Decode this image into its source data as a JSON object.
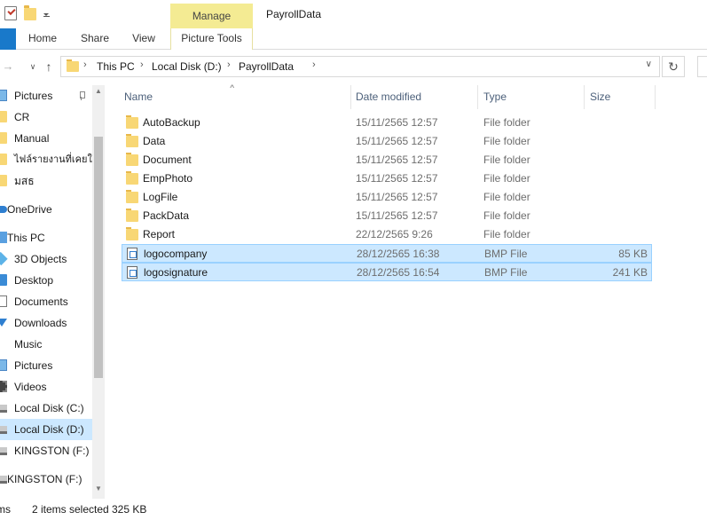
{
  "quick_access_toolbar": {
    "icons": [
      "properties-check-icon",
      "new-folder-icon",
      "customize-dropdown-icon"
    ]
  },
  "ribbon": {
    "contextual_group": "Manage",
    "tabs": [
      {
        "label": "Home"
      },
      {
        "label": "Share"
      },
      {
        "label": "View"
      },
      {
        "label": "Picture Tools"
      }
    ]
  },
  "window": {
    "title": "PayrollData"
  },
  "address": {
    "crumbs": [
      "This PC",
      "Local Disk (D:)",
      "PayrollData"
    ]
  },
  "nav_pane": {
    "items": [
      {
        "label": "Pictures",
        "icon": "pictures-icon",
        "pinned": true
      },
      {
        "label": "CR",
        "icon": "folder-icon"
      },
      {
        "label": "Manual",
        "icon": "folder-icon"
      },
      {
        "label": "ไฟล์รายงานที่เคยใช้",
        "icon": "folder-icon"
      },
      {
        "label": "มสธ",
        "icon": "folder-icon"
      },
      {
        "label": "OneDrive",
        "icon": "onedrive-icon"
      },
      {
        "label": "This PC",
        "icon": "this-pc-icon"
      },
      {
        "label": "3D Objects",
        "icon": "3d-objects-icon"
      },
      {
        "label": "Desktop",
        "icon": "desktop-icon"
      },
      {
        "label": "Documents",
        "icon": "documents-icon"
      },
      {
        "label": "Downloads",
        "icon": "downloads-icon"
      },
      {
        "label": "Music",
        "icon": "music-icon"
      },
      {
        "label": "Pictures",
        "icon": "pictures-icon"
      },
      {
        "label": "Videos",
        "icon": "videos-icon"
      },
      {
        "label": "Local Disk (C:)",
        "icon": "drive-icon"
      },
      {
        "label": "Local Disk (D:)",
        "icon": "drive-icon",
        "selected": true
      },
      {
        "label": "KINGSTON (F:)",
        "icon": "usb-drive-icon"
      },
      {
        "label": "KINGSTON (F:)",
        "icon": "usb-drive-icon"
      }
    ]
  },
  "file_list": {
    "columns": {
      "name": "Name",
      "date": "Date modified",
      "type": "Type",
      "size": "Size"
    },
    "rows": [
      {
        "name": "AutoBackup",
        "date": "15/11/2565 12:57",
        "type": "File folder",
        "size": "",
        "icon": "folder-icon",
        "selected": false
      },
      {
        "name": "Data",
        "date": "15/11/2565 12:57",
        "type": "File folder",
        "size": "",
        "icon": "folder-icon",
        "selected": false
      },
      {
        "name": "Document",
        "date": "15/11/2565 12:57",
        "type": "File folder",
        "size": "",
        "icon": "folder-icon",
        "selected": false
      },
      {
        "name": "EmpPhoto",
        "date": "15/11/2565 12:57",
        "type": "File folder",
        "size": "",
        "icon": "folder-icon",
        "selected": false
      },
      {
        "name": "LogFile",
        "date": "15/11/2565 12:57",
        "type": "File folder",
        "size": "",
        "icon": "folder-icon",
        "selected": false
      },
      {
        "name": "PackData",
        "date": "15/11/2565 12:57",
        "type": "File folder",
        "size": "",
        "icon": "folder-icon",
        "selected": false
      },
      {
        "name": "Report",
        "date": "22/12/2565 9:26",
        "type": "File folder",
        "size": "",
        "icon": "folder-icon",
        "selected": false
      },
      {
        "name": "logocompany",
        "date": "28/12/2565 16:38",
        "type": "BMP File",
        "size": "85 KB",
        "icon": "bmp-file-icon",
        "selected": true
      },
      {
        "name": "logosignature",
        "date": "28/12/2565 16:54",
        "type": "BMP File",
        "size": "241 KB",
        "icon": "bmp-file-icon",
        "selected": true
      }
    ]
  },
  "status_bar": {
    "item_count": "ms",
    "selected": "2 items selected",
    "size": "325 KB"
  }
}
